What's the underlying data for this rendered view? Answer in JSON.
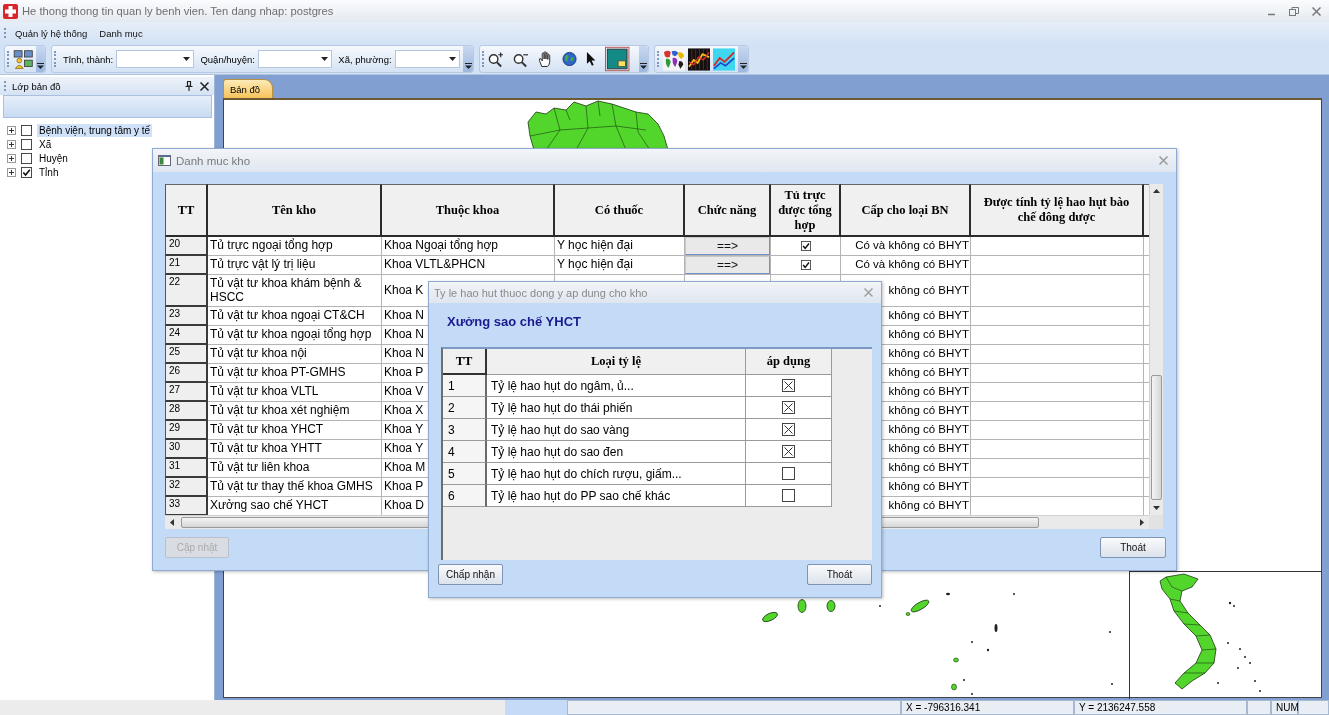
{
  "window": {
    "title": "He thong thong tin quan ly benh vien. Ten dang nhap: postgres"
  },
  "menu": [
    {
      "label": "Quản lý hệ thống"
    },
    {
      "label": "Danh mục"
    }
  ],
  "toolbar": {
    "filters": [
      {
        "label": "Tỉnh, thành:"
      },
      {
        "label": "Quận/huyện:"
      },
      {
        "label": "Xã, phường:"
      }
    ]
  },
  "layer_panel": {
    "title": "Lớp bản đồ",
    "items": [
      {
        "label": "Bệnh viện, trung tâm y tế",
        "checked": false,
        "selected": true
      },
      {
        "label": "Xã",
        "checked": false,
        "selected": false
      },
      {
        "label": "Huyện",
        "checked": false,
        "selected": false
      },
      {
        "label": "Tỉnh",
        "checked": true,
        "selected": false
      }
    ]
  },
  "tabs": [
    {
      "label": "Bản đồ",
      "selected": true
    }
  ],
  "dialog_kho": {
    "title": "Danh muc kho",
    "columns": [
      "TT",
      "Tên kho",
      "Thuộc khoa",
      "Có thuốc",
      "Chức năng",
      "Tủ trực được tổng hợp",
      "Cấp cho loại BN",
      "Được tính tỷ lệ hao hụt bào chế đông dược"
    ],
    "rows": [
      {
        "tt": "20",
        "ten_kho": "Tủ trực ngoại tổng hợp",
        "thuoc_khoa": "Khoa Ngoại tổng hợp",
        "co_thuoc": "Y học hiện đại",
        "chuc_nang": "==>",
        "tu_truc": true,
        "cap_cho_loai_bn": "Có và không có BHYT"
      },
      {
        "tt": "21",
        "ten_kho": "Tủ trực vật lý trị liệu",
        "thuoc_khoa": "Khoa VLTL&PHCN",
        "co_thuoc": "Y học hiện đại",
        "chuc_nang": "==>",
        "tu_truc": true,
        "cap_cho_loai_bn": "Có và không có BHYT"
      },
      {
        "tt": "22",
        "ten_kho": "Tủ vật tư khoa khám bệnh & HSCC",
        "thuoc_khoa": "Khoa K",
        "cap_cho_loai_bn": "không có BHYT"
      },
      {
        "tt": "23",
        "ten_kho": "Tủ vật tư khoa ngoại CT&CH",
        "thuoc_khoa": "Khoa N",
        "cap_cho_loai_bn": "không có BHYT"
      },
      {
        "tt": "24",
        "ten_kho": "Tủ vật tư khoa ngoại tổng hợp",
        "thuoc_khoa": "Khoa N",
        "cap_cho_loai_bn": "không có BHYT"
      },
      {
        "tt": "25",
        "ten_kho": "Tủ vật tư khoa nội",
        "thuoc_khoa": "Khoa N",
        "cap_cho_loai_bn": "không có BHYT"
      },
      {
        "tt": "26",
        "ten_kho": "Tủ vật tư khoa PT-GMHS",
        "thuoc_khoa": "Khoa P",
        "cap_cho_loai_bn": "không có BHYT"
      },
      {
        "tt": "27",
        "ten_kho": "Tủ vật tư khoa VLTL",
        "thuoc_khoa": "Khoa V",
        "cap_cho_loai_bn": "không có BHYT"
      },
      {
        "tt": "28",
        "ten_kho": "Tủ vật tư khoa xét nghiệm",
        "thuoc_khoa": "Khoa X",
        "cap_cho_loai_bn": "không có BHYT"
      },
      {
        "tt": "29",
        "ten_kho": "Tủ vật tư khoa YHCT",
        "thuoc_khoa": "Khoa Y",
        "cap_cho_loai_bn": "không có BHYT"
      },
      {
        "tt": "30",
        "ten_kho": "Tủ vật tư khoa YHTT",
        "thuoc_khoa": "Khoa Y",
        "cap_cho_loai_bn": "không có BHYT"
      },
      {
        "tt": "31",
        "ten_kho": "Tủ vật tư liên khoa",
        "thuoc_khoa": "Khoa M",
        "cap_cho_loai_bn": "không có BHYT"
      },
      {
        "tt": "32",
        "ten_kho": "Tủ vật tư thay thế khoa GMHS",
        "thuoc_khoa": "Khoa P",
        "cap_cho_loai_bn": "không có BHYT"
      },
      {
        "tt": "33",
        "ten_kho": "Xưởng sao chế YHCT",
        "thuoc_khoa": "Khoa D",
        "cap_cho_loai_bn": "không có BHYT"
      }
    ],
    "buttons": [
      {
        "label": "Cập nhật",
        "disabled": true
      },
      {
        "label": "Thoát",
        "disabled": false
      }
    ]
  },
  "dialog_ty_le": {
    "title": "Ty le hao hut thuoc dong y ap dung cho kho",
    "heading": "Xưởng sao chế YHCT",
    "columns": [
      "TT",
      "Loại tỷ lệ",
      "áp dụng"
    ],
    "rows": [
      {
        "tt": "1",
        "loai_ty_le": "Tỷ lệ hao hụt do ngâm, ủ...",
        "ap_dung": true
      },
      {
        "tt": "2",
        "loai_ty_le": "Tỷ lệ hao hụt do thái phiến",
        "ap_dung": true
      },
      {
        "tt": "3",
        "loai_ty_le": "Tỷ lệ hao hụt do sao vàng",
        "ap_dung": true
      },
      {
        "tt": "4",
        "loai_ty_le": "Tỷ lệ hao hụt do sao đen",
        "ap_dung": true
      },
      {
        "tt": "5",
        "loai_ty_le": "Tỷ lệ hao hụt do chích rượu, giấm...",
        "ap_dung": false
      },
      {
        "tt": "6",
        "loai_ty_le": "Tỷ lệ hao hụt do PP sao chế khác",
        "ap_dung": false
      }
    ],
    "buttons": [
      {
        "label": "Chấp nhận"
      },
      {
        "label": "Thoát"
      }
    ]
  },
  "status_bar": [
    {
      "text": "X = -796316.341"
    },
    {
      "text": "Y = 2136247.558"
    },
    {
      "text": "NUM"
    }
  ]
}
